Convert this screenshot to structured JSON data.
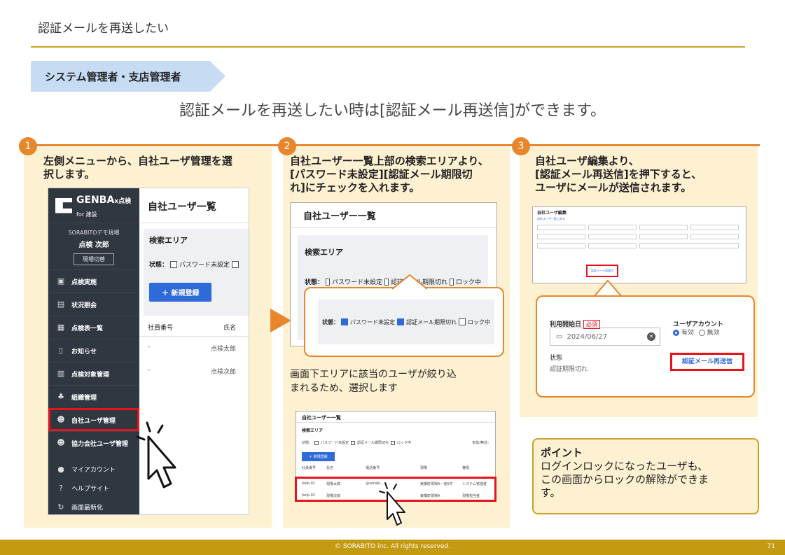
{
  "page": {
    "title": "認証メールを再送したい",
    "role": "システム管理者・支店管理者",
    "headline": "認証メールを再送したい時は[認証メール再送信]ができます。"
  },
  "steps": [
    {
      "number": "1",
      "text_lines": [
        "左側メニューから、自社ユーザ管理を選",
        "択します。"
      ]
    },
    {
      "number": "2",
      "text_lines": [
        "自社ユーザー一覧上部の検索エリアより、",
        "[パスワード未設定][認証メール期限切",
        "れ]にチェックを入れます。"
      ]
    },
    {
      "number": "3",
      "text_lines": [
        "自社ユーザ編集より、",
        "[認証メール再送信]を押下すると、",
        "ユーザにメールが送信されます。"
      ]
    }
  ],
  "app1": {
    "logo": "GENBA",
    "logo_suffix": "x点検",
    "logo_sub": "for 建設",
    "site_name": "SORABITOデモ現場",
    "site_user": "点検 次郎",
    "switch_label": "現場切替",
    "nav": [
      {
        "label": "点検実施",
        "icon": "clipboard-icon"
      },
      {
        "label": "状況照会",
        "icon": "monitor-icon"
      },
      {
        "label": "点検表一覧",
        "icon": "grid-icon"
      },
      {
        "label": "お知らせ",
        "icon": "document-icon"
      },
      {
        "label": "点検対象管理",
        "icon": "building-icon"
      },
      {
        "label": "組織管理",
        "icon": "org-chart-icon"
      },
      {
        "label": "自社ユーザ管理",
        "icon": "users-icon"
      },
      {
        "label": "協力会社ユーザ管理",
        "icon": "users-icon"
      }
    ],
    "sub_nav": [
      {
        "label": "マイアカウント",
        "icon": "person-icon"
      },
      {
        "label": "ヘルプサイト",
        "icon": "help-icon"
      },
      {
        "label": "画面最新化",
        "icon": "refresh-icon"
      }
    ],
    "main_title": "自社ユーザ一覧",
    "search_label": "検索エリア",
    "state_label": "状態：",
    "password_unset": "パスワード未設定",
    "new_button": "＋ 新規登録",
    "col_employee_no": "社員番号",
    "col_name": "氏名",
    "rows": [
      {
        "no": "-",
        "name": "点検太郎"
      },
      {
        "no": "-",
        "name": "点検次郎"
      }
    ]
  },
  "app2": {
    "title": "自社ユーザー一覧",
    "search_label": "検索エリア",
    "state_label": "状態：",
    "password_unset": "パスワード未設定",
    "auth_expired": "認証メール期限切れ",
    "locked": "ロック中"
  },
  "step2_sub_text": [
    "画面下エリアに該当のユーザが絞り込",
    "まれるため、選択します"
  ],
  "app3": {
    "title": "自社ユーザー一覧",
    "search_label": "検索エリア",
    "state_text": "状態：",
    "opt1": "パスワード未設定",
    "opt2": "認証メール期限切れ",
    "opt3": "ロック中",
    "valid_label": "有効/無効：",
    "new_button": "＋ 新規登録",
    "headers": [
      "社員番号",
      "氏名",
      "電話番号",
      "",
      "現場",
      "権限"
    ],
    "rows": [
      [
        "help-01",
        "現場太郎",
        "@sorabi…",
        "",
        "東橋町現場A・他5件",
        "システム管理者"
      ],
      [
        "help-02",
        "現場次郎",
        "",
        "",
        "東橋町現場A",
        "現場担当者"
      ]
    ]
  },
  "app4": {
    "title": "自社ユーザ編集",
    "back": "自社ユーザー覧に戻る",
    "resend": "認証メール再送信"
  },
  "callout3": {
    "start_label": "利用開始日",
    "required": "必須",
    "date": "2024/06/27",
    "account_label": "ユーザアカウント",
    "enabled": "有効",
    "disabled": "無効",
    "status_label": "状態",
    "status_value": "認証期限切れ",
    "resend": "認証メール再送信"
  },
  "point": {
    "title": "ポイント",
    "lines": [
      "ログインロックになったユーザも、",
      "この画面からロックの解除ができま",
      "す。"
    ]
  },
  "footer": {
    "copyright": "© SORABITO inc. All rights reserved.",
    "page_number": "71"
  },
  "colors": {
    "accent": "#e8862b",
    "panel_bg": "#fdf1d2",
    "highlight": "#e8121b",
    "footer": "#c49a12",
    "brand_blue": "#2f6bd8"
  }
}
